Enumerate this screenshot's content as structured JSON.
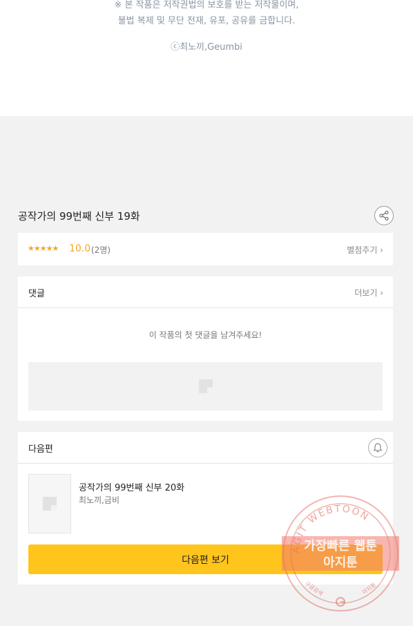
{
  "notice": {
    "line1": "※ 본 작품은 저작권법의 보호를 받는 저작물이며,",
    "line2": "불법 복제 및 무단 전재, 유포, 공유를 금합니다.",
    "copyright": "ⓒ최노끼,Geumbi"
  },
  "episode": {
    "title": "공작가의 99번째 신부 19화"
  },
  "rating": {
    "stars": "★★★★★",
    "score": "10.0",
    "count": "(2명)",
    "rate_link": "별점주기 ›"
  },
  "comments": {
    "title": "댓글",
    "more": "더보기 ›",
    "empty": "이 작품의 첫 댓글을 남겨주세요!"
  },
  "next": {
    "title": "다음편",
    "episode_title": "공작가의 99번째 신부 20화",
    "author": "최노끼,금비",
    "button": "다음편 보기"
  },
  "watermark": {
    "ring_text": "AGIT WEBTOON",
    "line1": "가장빠른 웹툰",
    "line2": "아지툰",
    "bottom_left": "구글검색",
    "bottom_right": "아지툰",
    "color": "#e05a50"
  },
  "colors": {
    "accent": "#ffc51d",
    "star": "#f5a623",
    "bg": "#f2f2f2"
  },
  "icons": {
    "share": "share-icon",
    "bell": "bell-icon",
    "placeholder": "image-placeholder-icon"
  }
}
